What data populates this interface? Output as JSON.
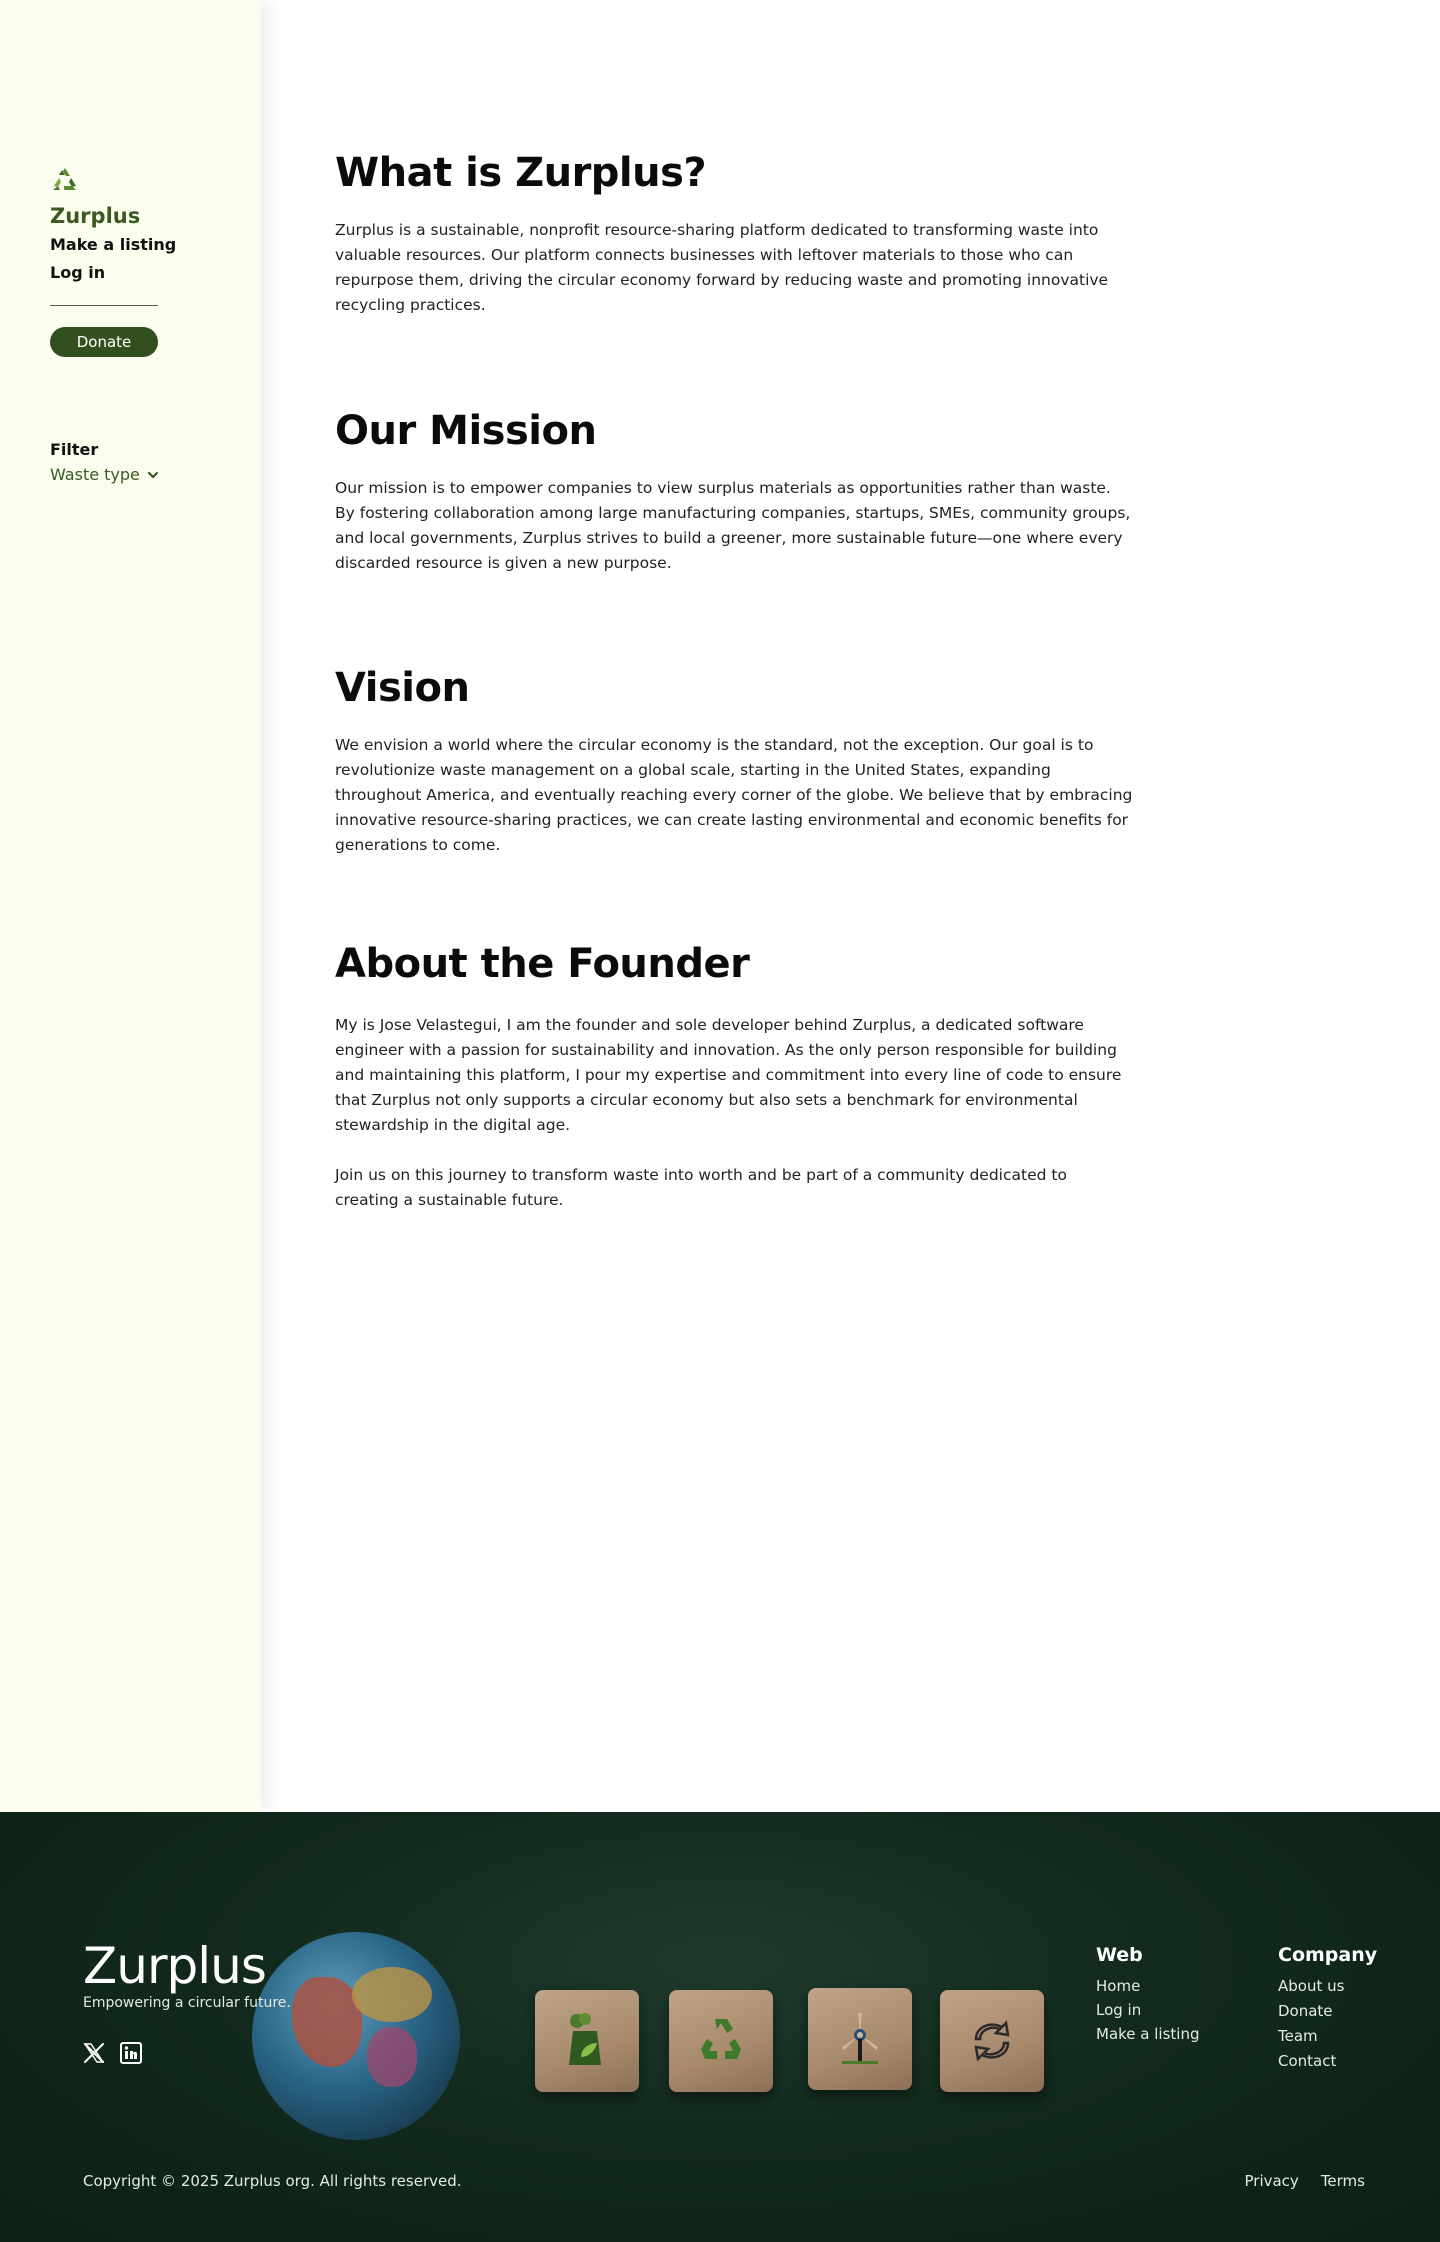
{
  "sidebar": {
    "logo_icon": "recycle-icon",
    "brand": "Zurplus",
    "make_listing": "Make a listing",
    "log_in": "Log in",
    "donate": "Donate",
    "filter_label": "Filter",
    "filter_value": "Waste type",
    "filter_icon": "chevron-down-icon"
  },
  "main": {
    "sections": [
      {
        "title": "What is Zurplus?",
        "paragraphs": [
          "Zurplus is a sustainable, nonprofit resource-sharing platform dedicated to transforming waste into valuable resources. Our platform connects businesses with leftover materials to those who can repurpose them, driving the circular economy forward by reducing waste and promoting innovative recycling practices."
        ]
      },
      {
        "title": "Our Mission",
        "paragraphs": [
          "Our mission is to empower companies to view surplus materials as opportunities rather than waste. By fostering collaboration among large manufacturing companies, startups, SMEs, community groups, and local governments, Zurplus strives to build a greener, more sustainable future—one where every discarded resource is given a new purpose."
        ]
      },
      {
        "title": "Vision",
        "paragraphs": [
          "We envision a world where the circular economy is the standard, not the exception. Our goal is to revolutionize waste management on a global scale, starting in the United States, expanding throughout America, and eventually reaching every corner of the globe. We believe that by embracing innovative resource-sharing practices, we can create lasting environmental and economic benefits for generations to come."
        ]
      },
      {
        "title": "About the Founder",
        "paragraphs": [
          "My is Jose Velastegui, I am the founder and sole developer behind Zurplus, a dedicated software engineer with a passion for sustainability and innovation. As the only person responsible for building and maintaining this platform, I pour my expertise and commitment into every line of code to ensure that Zurplus not only supports a circular economy but also sets a benchmark for environmental stewardship in the digital age.",
          "Join us on this journey to transform waste into worth and be part of a community dedicated to creating a sustainable future."
        ]
      }
    ]
  },
  "footer": {
    "brand": "Zurplus",
    "tagline": "Empowering a circular future.",
    "social": [
      "x-icon",
      "linkedin-icon"
    ],
    "web_heading": "Web",
    "web_links": [
      "Home",
      "Log in",
      "Make a listing"
    ],
    "company_heading": "Company",
    "company_links": [
      "About us",
      "Donate",
      "Team",
      "Contact"
    ],
    "copyright": "Copyright © 2025 Zurplus org. All rights reserved.",
    "legal_links": [
      "Privacy",
      "Terms"
    ],
    "image_icons": [
      "globe-icon",
      "factory-icon",
      "recycle-icon",
      "wind-turbine-icon",
      "refresh-icon"
    ]
  },
  "colors": {
    "sidebar_bg": "#fbfdef",
    "brand_green": "#3a5a22",
    "donate_bg": "#344f1f",
    "footer_bg": "#0f2419"
  }
}
